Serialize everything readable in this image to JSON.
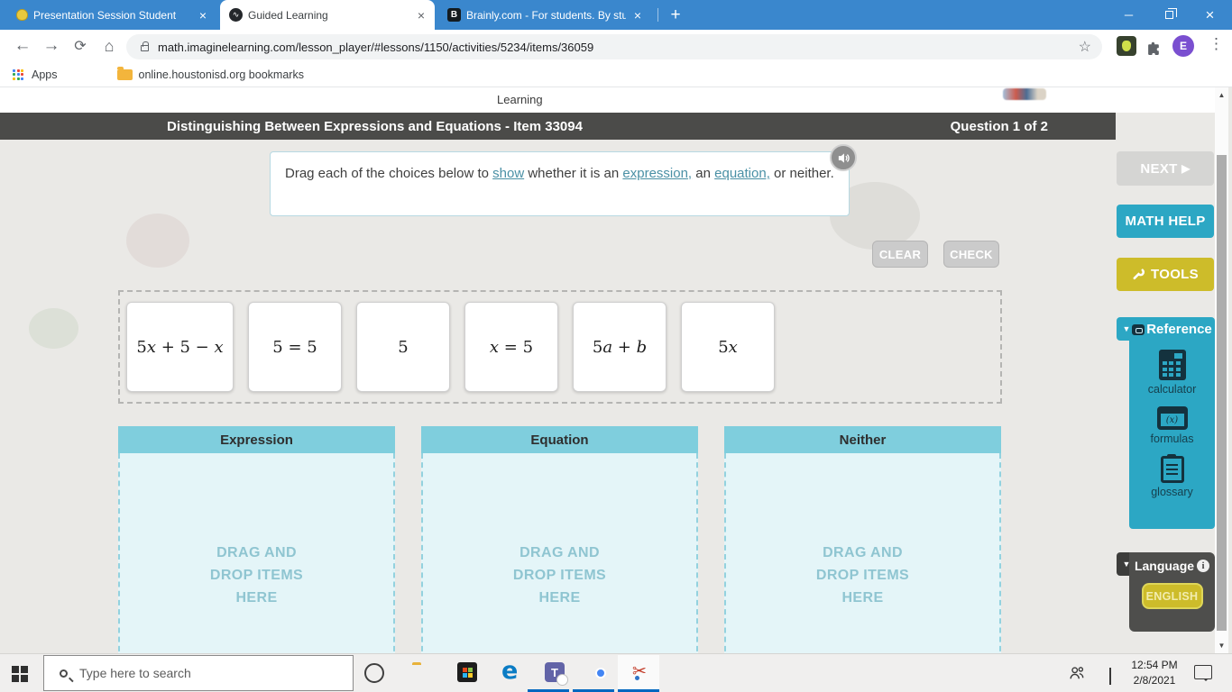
{
  "browser": {
    "tabs": [
      {
        "title": "Presentation Session Student"
      },
      {
        "title": "Guided Learning"
      },
      {
        "title": "Brainly.com - For students. By stu"
      }
    ],
    "url": "math.imaginelearning.com/lesson_player/#lessons/1150/activities/5234/items/36059",
    "bookmarks": {
      "apps_label": "Apps",
      "folder_label": "online.houstonisd.org bookmarks"
    }
  },
  "icons": {
    "tab_close": "×",
    "new_tab": "+",
    "minimize": "─",
    "close": "×",
    "back": "←",
    "forward": "→",
    "refresh": "⟳",
    "home": "⌂",
    "star": "☆",
    "menu": "⋮",
    "avatar_letter": "E",
    "brainly_letter": "B",
    "wave": "∿",
    "collapse": "▼",
    "next_arrow": "▶",
    "scroll_up": "▲",
    "scroll_down": "▼",
    "info": "i",
    "edge_letter": "e",
    "teams_letter": "T",
    "formulas_glyph": "(x)",
    "scissors": "✂"
  },
  "page": {
    "logo_text": "Learning",
    "header": {
      "title": "Distinguishing Between Expressions and Equations - Item 33094",
      "question_counter": "Question 1 of 2"
    },
    "instruction": {
      "part1": "Drag each of the choices below to ",
      "link1": "show",
      "part2": " whether it is an ",
      "link2": "expression,",
      "part3": " an ",
      "link3": "equation,",
      "part4": " or neither."
    },
    "buttons": {
      "clear": "CLEAR",
      "check": "CHECK"
    },
    "choices": [
      {
        "segments": [
          {
            "text": "5"
          },
          {
            "text": "x",
            "italic": true
          },
          {
            "text": " + 5 − "
          },
          {
            "text": "x",
            "italic": true
          }
        ]
      },
      {
        "segments": [
          {
            "text": "5 = 5"
          }
        ]
      },
      {
        "segments": [
          {
            "text": "5"
          }
        ]
      },
      {
        "segments": [
          {
            "text": "x",
            "italic": true
          },
          {
            "text": " = 5"
          }
        ]
      },
      {
        "segments": [
          {
            "text": "5"
          },
          {
            "text": "a",
            "italic": true
          },
          {
            "text": " + "
          },
          {
            "text": "b",
            "italic": true
          }
        ]
      },
      {
        "segments": [
          {
            "text": "5"
          },
          {
            "text": "x",
            "italic": true
          }
        ]
      }
    ],
    "drop_zones": [
      {
        "label": "Expression",
        "placeholder": "DRAG AND DROP ITEMS HERE"
      },
      {
        "label": "Equation",
        "placeholder": "DRAG AND DROP ITEMS HERE"
      },
      {
        "label": "Neither",
        "placeholder": "DRAG AND DROP ITEMS HERE"
      }
    ]
  },
  "sidebar": {
    "next_label": "NEXT",
    "math_help_label": "MATH HELP",
    "tools_label": "TOOLS",
    "reference": {
      "title": "Reference",
      "items": [
        {
          "label": "calculator"
        },
        {
          "label": "formulas"
        },
        {
          "label": "glossary"
        }
      ]
    },
    "language": {
      "title": "Language",
      "button_label": "ENGLISH"
    }
  },
  "taskbar": {
    "search_placeholder": "Type here to search",
    "time": "12:54 PM",
    "date": "2/8/2021"
  },
  "colors": {
    "titlebar_blue": "#3a87cd",
    "dark_bar": "#4b4b49",
    "accent_teal": "#2ca7c4",
    "zone_header_teal": "#7fcedd",
    "zone_body_teal": "#e4f5f8",
    "gold": "#cdbc2a",
    "link_teal": "#4a90a5",
    "taskbar_underline_blue": "#0067c0"
  }
}
